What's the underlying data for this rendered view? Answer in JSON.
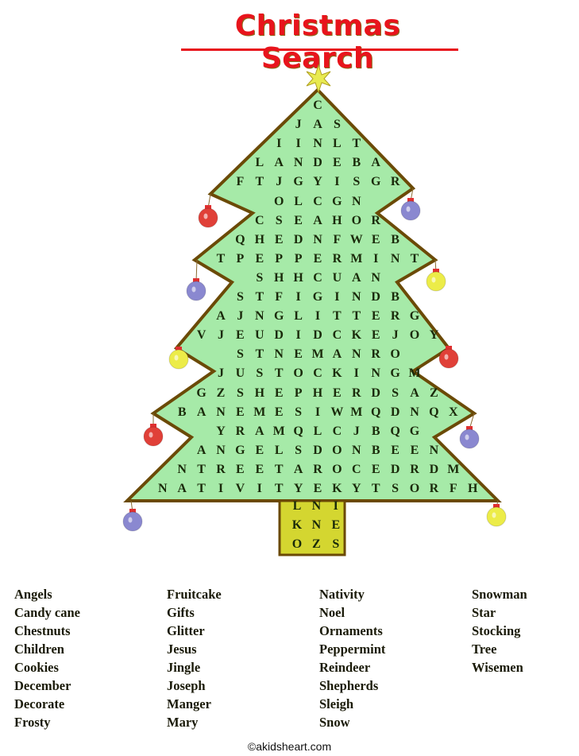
{
  "title": "Christmas Search",
  "colors": {
    "title": "#e8141c",
    "tree_fill": "#a6eaa8",
    "tree_outline": "#6b4a06",
    "trunk_fill": "#d4d630",
    "star": "#e8ea50",
    "ornament_red": "#e04038",
    "ornament_purple": "#8a88d0",
    "ornament_yellow": "#ecec48"
  },
  "tree_grid": [
    [
      "C"
    ],
    [
      "J",
      "A",
      "S"
    ],
    [
      "I",
      "I",
      "N",
      "L",
      "T"
    ],
    [
      "L",
      "A",
      "N",
      "D",
      "E",
      "B",
      "A"
    ],
    [
      "F",
      "T",
      "J",
      "G",
      "Y",
      "I",
      "S",
      "G",
      "R"
    ],
    [
      "O",
      "L",
      "C",
      "G",
      "N"
    ],
    [
      "C",
      "S",
      "E",
      "A",
      "H",
      "O",
      "R"
    ],
    [
      "Q",
      "H",
      "E",
      "D",
      "N",
      "F",
      "W",
      "E",
      "B"
    ],
    [
      "T",
      "P",
      "E",
      "P",
      "P",
      "E",
      "R",
      "M",
      "I",
      "N",
      "T"
    ],
    [
      "S",
      "H",
      "H",
      "C",
      "U",
      "A",
      "N"
    ],
    [
      "S",
      "T",
      "F",
      "I",
      "G",
      "I",
      "N",
      "D",
      "B"
    ],
    [
      "A",
      "J",
      "N",
      "G",
      "L",
      "I",
      "T",
      "T",
      "E",
      "R",
      "G"
    ],
    [
      "V",
      "J",
      "E",
      "U",
      "D",
      "I",
      "D",
      "C",
      "K",
      "E",
      "J",
      "O",
      "Y"
    ],
    [
      "S",
      "T",
      "N",
      "E",
      "M",
      "A",
      "N",
      "R",
      "O"
    ],
    [
      "J",
      "U",
      "S",
      "T",
      "O",
      "C",
      "K",
      "I",
      "N",
      "G",
      "M"
    ],
    [
      "G",
      "Z",
      "S",
      "H",
      "E",
      "P",
      "H",
      "E",
      "R",
      "D",
      "S",
      "A",
      "Z"
    ],
    [
      "B",
      "A",
      "N",
      "E",
      "M",
      "E",
      "S",
      "I",
      "W",
      "M",
      "Q",
      "D",
      "N",
      "Q",
      "X"
    ],
    [
      "Y",
      "R",
      "A",
      "M",
      "Q",
      "L",
      "C",
      "J",
      "B",
      "Q",
      "G"
    ],
    [
      "A",
      "N",
      "G",
      "E",
      "L",
      "S",
      "D",
      "O",
      "N",
      "B",
      "E",
      "E",
      "N"
    ],
    [
      "N",
      "T",
      "R",
      "E",
      "E",
      "T",
      "A",
      "R",
      "O",
      "C",
      "E",
      "D",
      "R",
      "D",
      "M"
    ],
    [
      "N",
      "A",
      "T",
      "I",
      "V",
      "I",
      "T",
      "Y",
      "E",
      "K",
      "Y",
      "T",
      "S",
      "O",
      "R",
      "F",
      "H"
    ]
  ],
  "trunk_grid": [
    [
      "L",
      "N",
      "I"
    ],
    [
      "K",
      "N",
      "E"
    ],
    [
      "O",
      "Z",
      "S"
    ]
  ],
  "word_list": [
    [
      "Angels",
      "Candy cane",
      "Chestnuts",
      "Children",
      "Cookies",
      "December",
      "Decorate",
      "Frosty"
    ],
    [
      "Fruitcake",
      "Gifts",
      "Glitter",
      "Jesus",
      "Jingle",
      "Joseph",
      "Manger",
      "Mary"
    ],
    [
      "Nativity",
      "Noel",
      "Ornaments",
      "Peppermint",
      "Reindeer",
      "Shepherds",
      "Sleigh",
      "Snow"
    ],
    [
      "Snowman",
      "Star",
      "Stocking",
      "Tree",
      "Wisemen"
    ]
  ],
  "footer": "©akidsheart.com"
}
